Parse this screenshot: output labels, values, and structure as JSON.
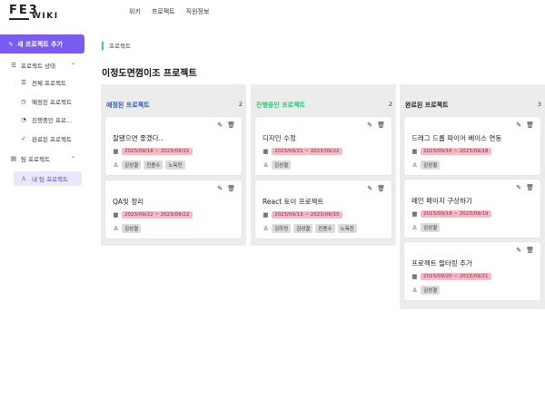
{
  "logo": {
    "big": "FE3",
    "small": "WIKI"
  },
  "nav": [
    "위키",
    "프로젝트",
    "직원정보"
  ],
  "sidebar": {
    "new_button": "새 프로젝트 추가",
    "status_group": "프로젝트 상태",
    "status_items": [
      "전체 프로젝트",
      "예정된 프로젝트",
      "진행중인 프로...",
      "완료된 프로젝트"
    ],
    "team_group": "팀 프로젝트",
    "team_items": [
      "내 팀 프로젝트"
    ]
  },
  "breadcrumb": "프로젝트",
  "page_title": "이정도면껌이조 프로젝트",
  "colors": {
    "accent": "#7b5cf0",
    "planned": "#2b5aa8",
    "progress": "#2fbf7a",
    "done": "#222222",
    "date_bg": "#f4bcc8"
  },
  "columns": [
    {
      "title": "예정된 프로젝트",
      "count": "2",
      "cards": [
        {
          "title": "잘됐으면 좋겠다..",
          "date": "2023/09/18 ~ 2023/09/21",
          "members": [
            "김성결",
            "진종수",
            "노옥진"
          ]
        },
        {
          "title": "QA및 정리",
          "date": "2023/09/22 ~ 2023/09/22",
          "members": [
            "김성결"
          ]
        }
      ]
    },
    {
      "title": "진행중인 프로젝트",
      "count": "2",
      "cards": [
        {
          "title": "디자인 수정",
          "date": "2023/09/21 ~ 2023/09/22",
          "members": [
            "김성결"
          ]
        },
        {
          "title": "React 토이 프로젝트",
          "date": "2023/09/13 ~ 2023/09/15",
          "members": [
            "김하정",
            "김성결",
            "진종수",
            "노옥진"
          ]
        }
      ]
    },
    {
      "title": "완료된 프로젝트",
      "count": "3",
      "cards": [
        {
          "title": "드래그 드롭 파이어 베이스 연동",
          "date": "2023/09/16 ~ 2023/09/18",
          "members": [
            "김성결"
          ]
        },
        {
          "title": "메인 페이지 구상하기",
          "date": "2023/09/18 ~ 2023/09/19",
          "members": [
            "김성결"
          ]
        },
        {
          "title": "프로젝트 필터링 추가",
          "date": "2023/09/20 ~ 2023/09/21",
          "members": [
            "김성결"
          ]
        }
      ]
    }
  ]
}
